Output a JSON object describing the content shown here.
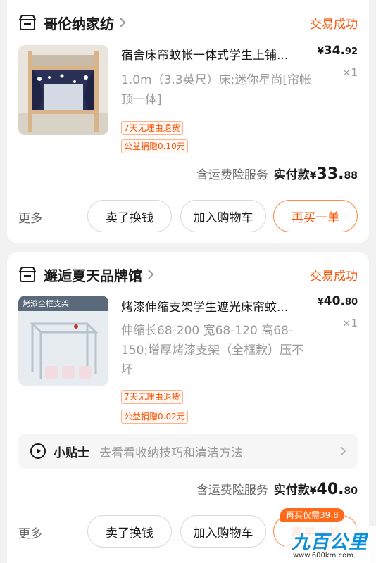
{
  "orders": [
    {
      "shop_name": "哥伦纳家纺",
      "status": "交易成功",
      "item_title": "宿舍床帘蚊帐一体式学生上铺...",
      "item_spec": "1.0m（3.3英尺）床;迷你星尚[帘帐顶一体]",
      "price_currency": "¥",
      "price_int": "34.",
      "price_dec": "92",
      "quantity": "×1",
      "tags": [
        "7天无理由退货",
        "公益捐赠0.10元"
      ],
      "insurance_text": "含运费险服务",
      "paid_label": "实付款",
      "paid_currency": "¥",
      "paid_int": "33.",
      "paid_dec": "88",
      "more_label": "更多",
      "buttons": [
        "卖了换钱",
        "加入购物车",
        "再买一单"
      ]
    },
    {
      "shop_name": "邂逅夏天品牌馆",
      "status": "交易成功",
      "item_title": "烤漆伸缩支架学生遮光床帘蚊...",
      "item_spec": "伸缩长68-200 宽68-120 高68-150;增厚烤漆支架（全框款）压不坏",
      "price_currency": "¥",
      "price_int": "40.",
      "price_dec": "80",
      "quantity": "×1",
      "tags": [
        "7天无理由退货",
        "公益捐赠0.02元"
      ],
      "tips_label": "小贴士",
      "tips_text": "去看看收纳技巧和清洁方法",
      "insurance_text": "含运费险服务",
      "paid_label": "实付款",
      "paid_currency": "¥",
      "paid_int": "40.",
      "paid_dec": "80",
      "more_label": "更多",
      "buttons": [
        "卖了换钱",
        "加入购物车",
        "再买一单"
      ],
      "repurchase_badge": "再买仅需39.8",
      "thumb_caption": "烤漆全框支架"
    }
  ],
  "watermark": {
    "logo_text": "九百公里",
    "url": "www.600km.com"
  },
  "colors": {
    "accent": "#ff5000",
    "page_bg": "#f2f2f2",
    "card_bg": "#ffffff",
    "muted": "#9a9a9a",
    "watermark_blue": "#0a8fd8"
  },
  "icons": [
    "shop-icon",
    "chevron-right-icon",
    "play-circle-icon"
  ]
}
